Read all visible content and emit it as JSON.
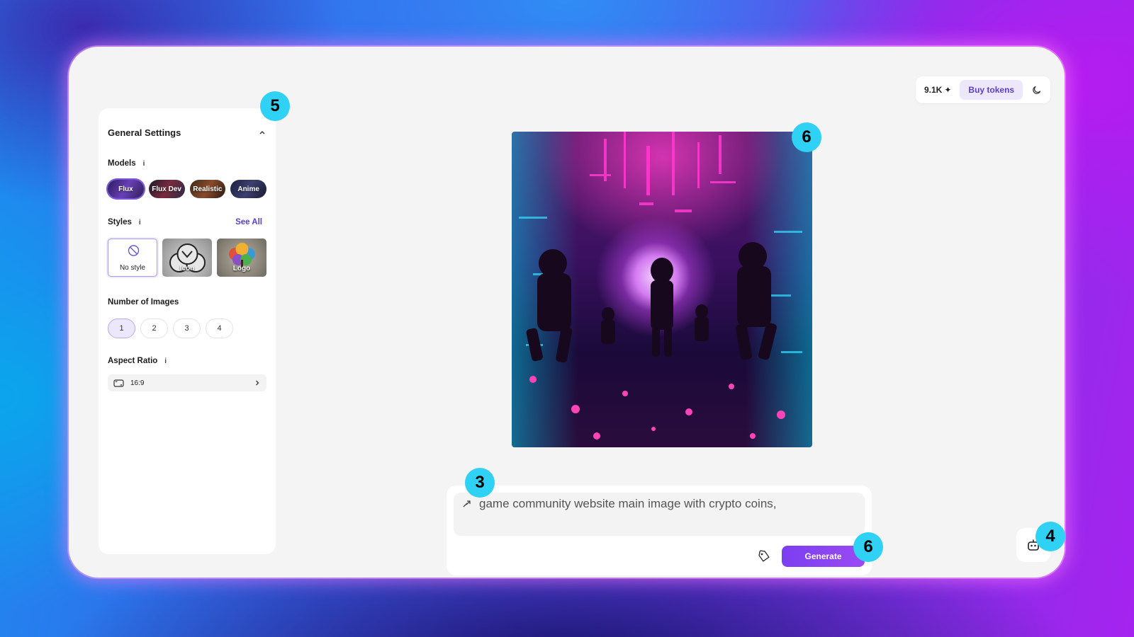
{
  "topbar": {
    "tokens": "9.1K",
    "buy_label": "Buy tokens"
  },
  "panel": {
    "title": "General Settings",
    "models_label": "Models",
    "info_glyph": "i",
    "models": [
      "Flux",
      "Flux Dev",
      "Realistic",
      "Anime"
    ],
    "styles_label": "Styles",
    "see_all": "See All",
    "styles": [
      "No style",
      "Icon",
      "Logo"
    ],
    "images_label": "Number of Images",
    "counts": [
      "1",
      "2",
      "3",
      "4"
    ],
    "selected_count": "1",
    "ratio_label": "Aspect Ratio",
    "ratio_value": "16:9"
  },
  "prompt": {
    "text": "game community website main image with crypto coins,",
    "generate_label": "Generate"
  },
  "badges": {
    "panel": "5",
    "image": "6",
    "prompt": "3",
    "generate": "6",
    "robot": "4"
  },
  "colors": {
    "accent": "#7b3ff0",
    "badge": "#2fd1f5",
    "selected_bg": "#ece7fb"
  }
}
